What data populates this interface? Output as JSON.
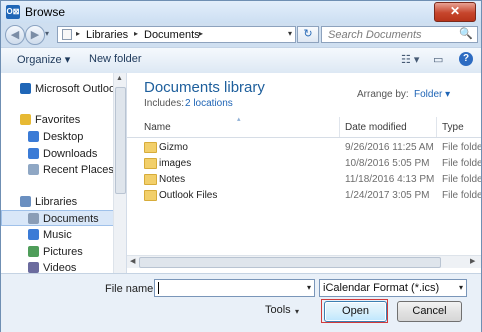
{
  "window": {
    "title": "Browse",
    "app_icon_text": "O⊠",
    "close_label": "✕"
  },
  "nav": {
    "back_glyph": "◀",
    "forward_glyph": "▶",
    "recent_glyph": "▾",
    "address": {
      "parts": [
        "Libraries",
        "Documents"
      ],
      "separator": "▸",
      "dropdown_glyph": "▾"
    },
    "refresh_glyph": "↻",
    "search": {
      "placeholder": "Search Documents",
      "icon": "🔍"
    }
  },
  "toolbar": {
    "organize_label": "Organize ▾",
    "new_folder_label": "New folder",
    "views_glyph": "☷ ▾",
    "preview_glyph": "▭",
    "help_label": "?"
  },
  "sidebar": {
    "items": [
      {
        "label": "Microsoft Outlook",
        "color": "#1f66b7",
        "indent": false
      },
      {
        "label": "Favorites",
        "color": "#e7b933",
        "indent": false
      },
      {
        "label": "Desktop",
        "color": "#3b7bd6",
        "indent": true
      },
      {
        "label": "Downloads",
        "color": "#3b7bd6",
        "indent": true
      },
      {
        "label": "Recent Places",
        "color": "#8fa7c4",
        "indent": true
      },
      {
        "label": "Libraries",
        "color": "#6a8fc0",
        "indent": false
      },
      {
        "label": "Documents",
        "color": "#8a9db6",
        "indent": true,
        "selected": true
      },
      {
        "label": "Music",
        "color": "#3b7bd6",
        "indent": true
      },
      {
        "label": "Pictures",
        "color": "#4f9d5a",
        "indent": true
      },
      {
        "label": "Videos",
        "color": "#6b6b9e",
        "indent": true
      }
    ]
  },
  "library": {
    "title": "Documents library",
    "includes_label": "Includes:",
    "includes_link": "2 locations",
    "arrange_label": "Arrange by:",
    "arrange_value": "Folder ▾"
  },
  "columns": {
    "name": "Name",
    "date": "Date modified",
    "type": "Type",
    "sort_glyph": "▴"
  },
  "files": [
    {
      "name": "Gizmo",
      "date": "9/26/2016 11:25 AM",
      "type": "File folder"
    },
    {
      "name": "images",
      "date": "10/8/2016 5:05 PM",
      "type": "File folder"
    },
    {
      "name": "Notes",
      "date": "11/18/2016 4:13 PM",
      "type": "File folder"
    },
    {
      "name": "Outlook Files",
      "date": "1/24/2017 3:05 PM",
      "type": "File folder"
    }
  ],
  "footer": {
    "file_name_label": "File name:",
    "file_name_value": "",
    "file_type_value": "iCalendar Format (*.ics)",
    "tools_label": "Tools",
    "open_label": "Open",
    "cancel_label": "Cancel",
    "dropdown_glyph": "▾"
  },
  "colors": {
    "open_highlight": "#d23b3b",
    "link": "#1f65b6",
    "title_green": "#1e5f9c"
  }
}
